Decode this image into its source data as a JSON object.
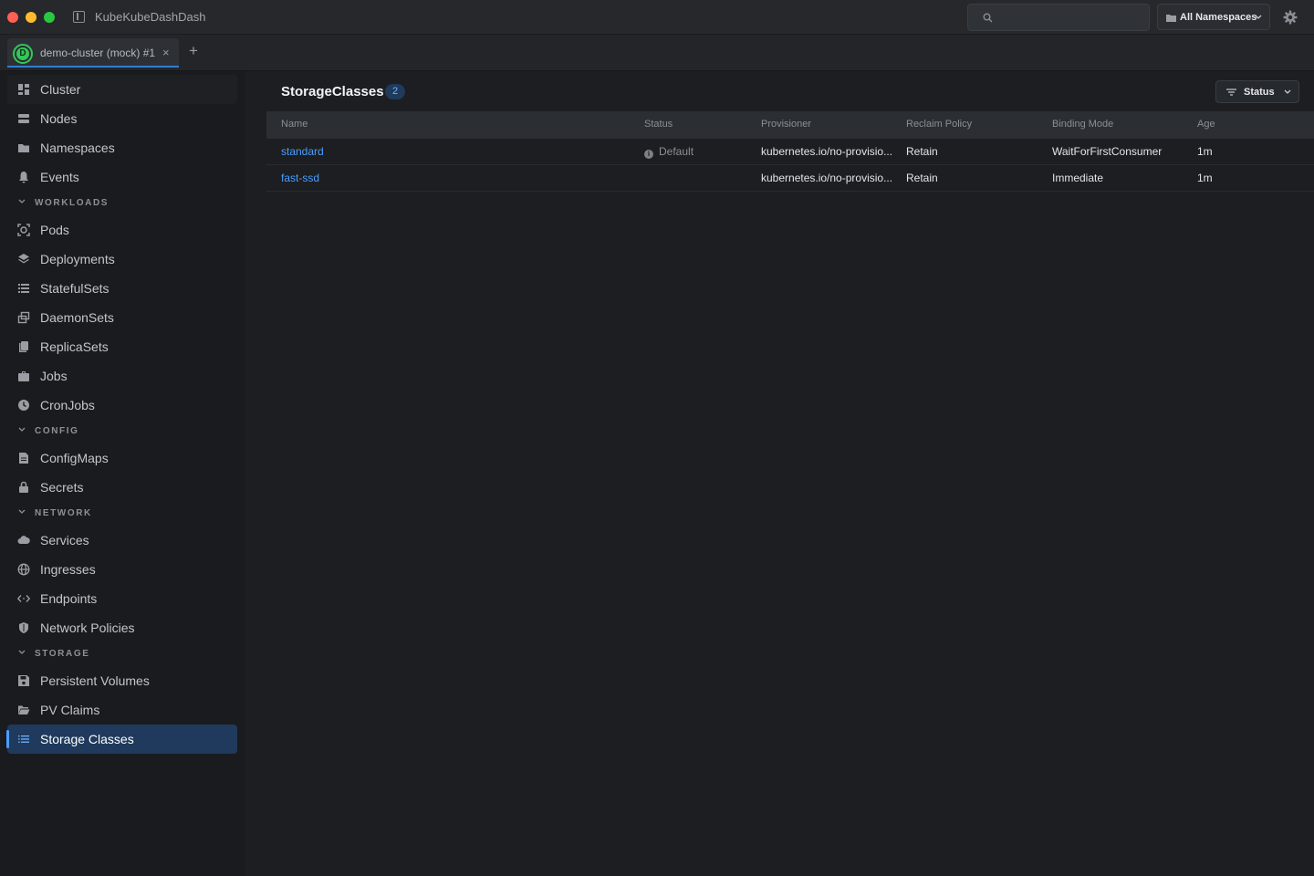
{
  "window": {
    "title": "KubeKubeDashDash"
  },
  "search": {
    "placeholder": "",
    "value": ""
  },
  "namespace_selector": {
    "label": "All Namespaces"
  },
  "tabs": [
    {
      "label": "demo-cluster (mock) #1",
      "avatar_letter": "D",
      "avatar_color": "#34c759"
    }
  ],
  "sidebar": {
    "top_items": [
      {
        "label": "Cluster",
        "icon": "dashboard-icon"
      },
      {
        "label": "Nodes",
        "icon": "server-icon"
      },
      {
        "label": "Namespaces",
        "icon": "folder-icon"
      },
      {
        "label": "Events",
        "icon": "bell-icon"
      }
    ],
    "sections": [
      {
        "title": "WORKLOADS",
        "items": [
          {
            "label": "Pods",
            "icon": "pod-icon"
          },
          {
            "label": "Deployments",
            "icon": "layers-icon"
          },
          {
            "label": "StatefulSets",
            "icon": "list-icon"
          },
          {
            "label": "DaemonSets",
            "icon": "copy-icon"
          },
          {
            "label": "ReplicaSets",
            "icon": "duplicate-icon"
          },
          {
            "label": "Jobs",
            "icon": "briefcase-icon"
          },
          {
            "label": "CronJobs",
            "icon": "clock-icon"
          }
        ]
      },
      {
        "title": "CONFIG",
        "items": [
          {
            "label": "ConfigMaps",
            "icon": "document-icon"
          },
          {
            "label": "Secrets",
            "icon": "lock-icon"
          }
        ]
      },
      {
        "title": "NETWORK",
        "items": [
          {
            "label": "Services",
            "icon": "cloud-icon"
          },
          {
            "label": "Ingresses",
            "icon": "globe-icon"
          },
          {
            "label": "Endpoints",
            "icon": "code-icon"
          },
          {
            "label": "Network Policies",
            "icon": "shield-icon"
          }
        ]
      },
      {
        "title": "STORAGE",
        "items": [
          {
            "label": "Persistent Volumes",
            "icon": "save-icon"
          },
          {
            "label": "PV Claims",
            "icon": "folder-open-icon"
          },
          {
            "label": "Storage Classes",
            "icon": "list-icon",
            "active": true
          }
        ]
      }
    ]
  },
  "main": {
    "title": "StorageClasses",
    "count": "2",
    "filter_label": "Status",
    "columns": [
      "Name",
      "Status",
      "Provisioner",
      "Reclaim Policy",
      "Binding Mode",
      "Age"
    ],
    "rows": [
      {
        "name": "standard",
        "status": "Default",
        "provisioner": "kubernetes.io/no-provisio...",
        "reclaim": "Retain",
        "binding": "WaitForFirstConsumer",
        "age": "1m"
      },
      {
        "name": "fast-ssd",
        "status": "",
        "provisioner": "kubernetes.io/no-provisio...",
        "reclaim": "Retain",
        "binding": "Immediate",
        "age": "1m"
      }
    ]
  },
  "colors": {
    "accent": "#4a9eff",
    "active_bg": "#1f3a5c",
    "cluster_green": "#34c759"
  }
}
